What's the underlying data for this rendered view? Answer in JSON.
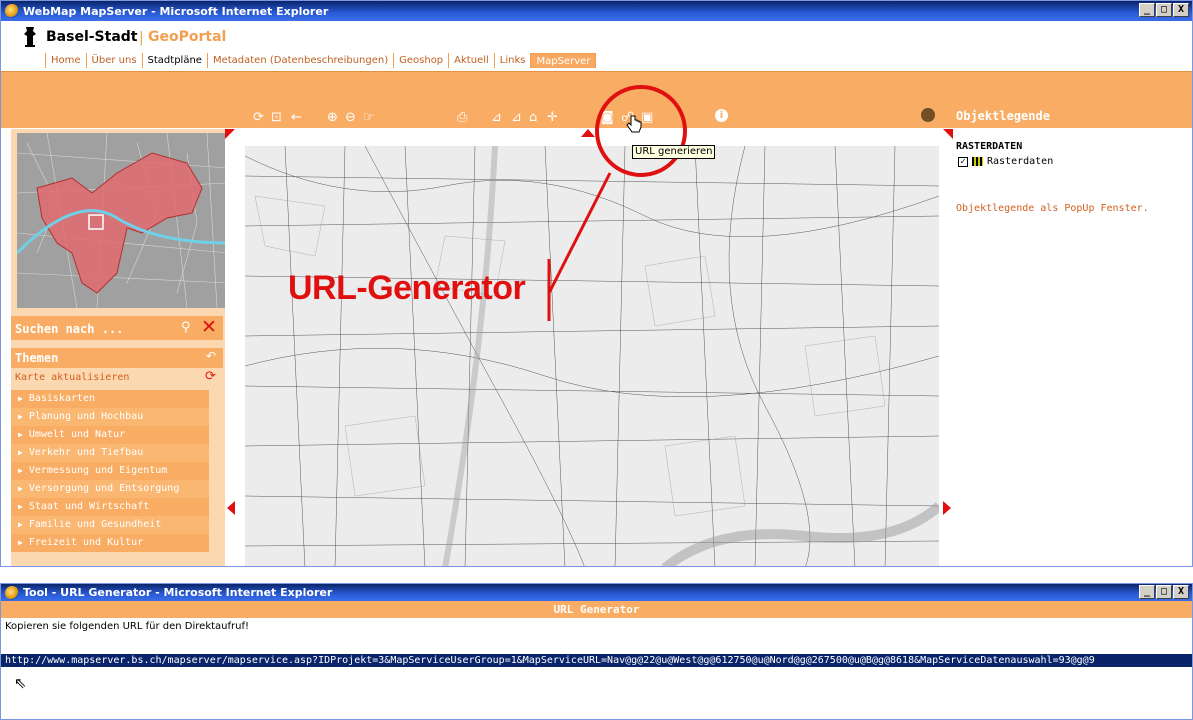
{
  "window1": {
    "title": "WebMap MapServer - Microsoft Internet Explorer",
    "controls": [
      "_",
      "□",
      "X"
    ]
  },
  "brand": {
    "name": "Basel-Stadt",
    "separator": "|",
    "portal": "GeoPortal"
  },
  "nav": {
    "items": [
      "Home",
      "Über uns",
      "Stadtpläne",
      "Metadaten (Datenbeschreibungen)",
      "Geoshop",
      "Aktuell",
      "Links",
      "MapServer"
    ],
    "active": "MapServer"
  },
  "toolbar": {
    "legend_title": "Objektlegende",
    "info_label": "i",
    "tooltip": "URL generieren"
  },
  "sidebar": {
    "search_label": "Suchen nach ...",
    "themen_label": "Themen",
    "refresh_label": "Karte aktualisieren",
    "themes": [
      "Basiskarten",
      "Planung und Hochbau",
      "Umwelt und Natur",
      "Verkehr und Tiefbau",
      "Vermessung und Eigentum",
      "Versorgung und Entsorgung",
      "Staat und Wirtschaft",
      "Familie und Gesundheit",
      "Freizeit und Kultur"
    ]
  },
  "legend": {
    "section": "RASTERDATEN",
    "item": "Rasterdaten",
    "item_checked": true,
    "popup_link": "Objektlegende als PopUp Fenster."
  },
  "annotation": "URL-Generator",
  "window2": {
    "title": "Tool - URL Generator - Microsoft Internet Explorer",
    "header": "URL Generator",
    "instruction": "Kopieren sie folgenden URL für den Direktaufruf!",
    "url": "http://www.mapserver.bs.ch/mapserver/mapservice.asp?IDProjekt=3&MapServiceUserGroup=1&MapServiceURL=Nav@g@22@u@West@g@612750@u@Nord@g@267500@u@B@g@8618&MapServiceDatenauswahl=93@g@9"
  },
  "colors": {
    "accent": "#f9ad64",
    "annotation": "#e01010",
    "link": "#d06020"
  },
  "icons": [
    "crest-icon",
    "refresh-icon",
    "zoom-in-icon",
    "zoom-out-icon",
    "print-icon",
    "url-generator-icon",
    "info-icon",
    "detective-icon",
    "search-icon",
    "close-icon",
    "themen-collapse-icon"
  ]
}
